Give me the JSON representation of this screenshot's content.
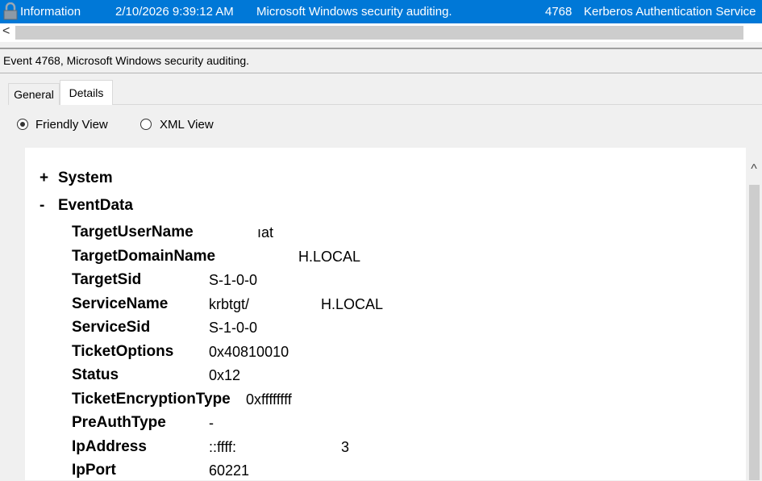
{
  "event_list_row": {
    "level": "Information",
    "datetime": "2/10/2026 9:39:12 AM",
    "source": "Microsoft Windows security auditing.",
    "event_id": "4768",
    "category": "Kerberos Authentication Service",
    "icon": "lock-icon"
  },
  "scroll": {
    "left_arrow": "<",
    "up_arrow": "^"
  },
  "event_header": {
    "title": "Event 4768, Microsoft Windows security auditing."
  },
  "tabs": {
    "general": "General",
    "details": "Details"
  },
  "views": {
    "friendly": "Friendly View",
    "xml": "XML View",
    "selected": "Friendly View"
  },
  "tree": {
    "system": {
      "toggle": "+",
      "label": "System"
    },
    "eventdata": {
      "toggle": "-",
      "label": "EventData"
    }
  },
  "fields": [
    {
      "key": "TargetUserName",
      "value": "ıat"
    },
    {
      "key": "TargetDomainName",
      "value": "H.LOCAL"
    },
    {
      "key": "TargetSid",
      "value": "S-1-0-0"
    },
    {
      "key": "ServiceName",
      "value": "krbtgt/",
      "value2": "H.LOCAL"
    },
    {
      "key": "ServiceSid",
      "value": "S-1-0-0"
    },
    {
      "key": "TicketOptions",
      "value": "0x40810010"
    },
    {
      "key": "Status",
      "value": "0x12"
    },
    {
      "key": "TicketEncryptionType",
      "value": "0xffffffff"
    },
    {
      "key": "PreAuthType",
      "value": "-"
    },
    {
      "key": "IpAddress",
      "value": "::ffff:",
      "value2": "3"
    },
    {
      "key": "IpPort",
      "value": "60221"
    }
  ]
}
